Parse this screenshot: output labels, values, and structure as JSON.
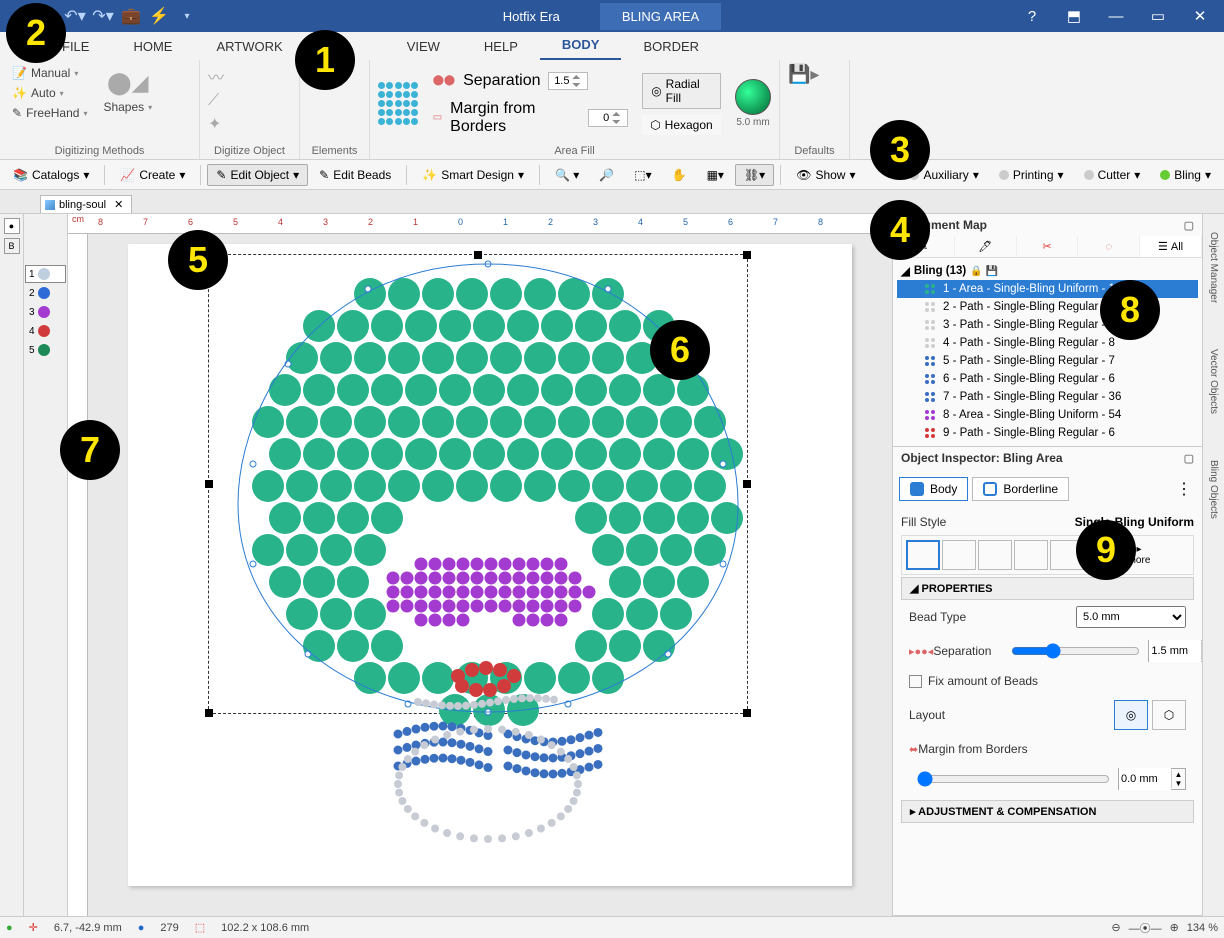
{
  "annotations": {
    "1": "1",
    "2": "2",
    "3": "3",
    "4": "4",
    "5": "5",
    "6": "6",
    "7": "7",
    "8": "8",
    "9": "9"
  },
  "titlebar": {
    "app_title": "Hotfix Era",
    "context_tab": "BLING AREA"
  },
  "menu_tabs": {
    "file": "FILE",
    "home": "HOME",
    "artwork": "ARTWORK",
    "view": "VIEW",
    "help": "HELP",
    "body": "BODY",
    "border": "BORDER"
  },
  "ribbon": {
    "groups": {
      "digitizing": "Digitizing Methods",
      "digitize_obj": "Digitize Object",
      "elements": "Elements",
      "area_fill": "Area Fill",
      "defaults": "Defaults"
    },
    "buttons": {
      "manual": "Manual",
      "auto": "Auto",
      "freehand": "FreeHand",
      "shapes": "Shapes",
      "separation": "Separation",
      "margin": "Margin from Borders",
      "radial": "Radial Fill",
      "hexagon": "Hexagon",
      "size": "5.0 mm"
    },
    "values": {
      "separation": "1.5",
      "margin": "0"
    }
  },
  "toolbar2": {
    "items": {
      "catalogs": "Catalogs",
      "create": "Create",
      "edit_obj": "Edit Object",
      "edit_beads": "Edit Beads",
      "smart": "Smart Design",
      "show": "Show",
      "auxiliary": "Auxiliary",
      "printing": "Printing",
      "cutter": "Cutter",
      "bling": "Bling"
    }
  },
  "file_tab": {
    "name": "bling-soul"
  },
  "ruler_unit": "cm",
  "bead_palette": [
    {
      "n": "1",
      "color": "#bfcfe0"
    },
    {
      "n": "2",
      "color": "#2f6bd6"
    },
    {
      "n": "3",
      "color": "#a43bd1"
    },
    {
      "n": "4",
      "color": "#d23b3b"
    },
    {
      "n": "5",
      "color": "#1d8a55"
    }
  ],
  "doc_map": {
    "title": "Document Map",
    "all_label": "All",
    "root": "Bling (13)",
    "items": [
      {
        "label": "1 - Area - Single-Bling Uniform - 130",
        "sel": true,
        "color": "#29b38a"
      },
      {
        "label": "2 - Path - Single-Bling Regular - 18",
        "color": "#cfcfcf"
      },
      {
        "label": "3 - Path - Single-Bling Regular - 8",
        "color": "#cfcfcf"
      },
      {
        "label": "4 - Path - Single-Bling Regular - 8",
        "color": "#cfcfcf"
      },
      {
        "label": "5 - Path - Single-Bling Regular - 7",
        "color": "#3a6fbf"
      },
      {
        "label": "6 - Path - Single-Bling Regular - 6",
        "color": "#3a6fbf"
      },
      {
        "label": "7 - Path - Single-Bling Regular - 36",
        "color": "#3a6fbf"
      },
      {
        "label": "8 - Area - Single-Bling Uniform - 54",
        "color": "#a43bd1"
      },
      {
        "label": "9 - Path - Single-Bling Regular - 6",
        "color": "#d23b3b"
      }
    ]
  },
  "inspector": {
    "title": "Object Inspector: Bling Area",
    "tabs": {
      "body": "Body",
      "border": "Borderline"
    },
    "fill_style_label": "Fill Style",
    "fill_style_name": "Single-Bling Uniform",
    "more": "more",
    "properties": "PROPERTIES",
    "bead_type_label": "Bead Type",
    "bead_type_value": "5.0 mm",
    "separation_label": "Separation",
    "separation_value": "1.5 mm",
    "fix_beads": "Fix amount of Beads",
    "layout": "Layout",
    "margin_label": "Margin from Borders",
    "margin_value": "0.0 mm",
    "adjustment": "ADJUSTMENT & COMPENSATION"
  },
  "side_tabs": {
    "obj_mgr": "Object Manager",
    "vector": "Vector Objects",
    "bling": "Bling Objects"
  },
  "status": {
    "coords": "6.7, -42.9 mm",
    "beads": "279",
    "size": "102.2 x 108.6 mm",
    "zoom": "134 %"
  }
}
